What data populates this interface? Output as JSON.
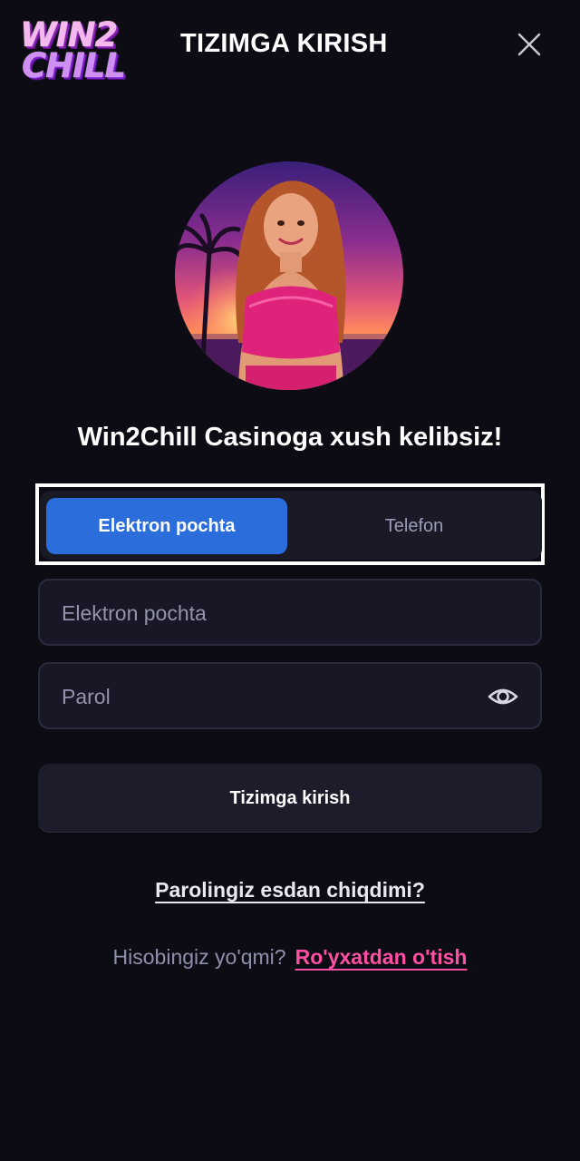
{
  "header": {
    "logo_line1": "WIN2",
    "logo_line2": "CHILL",
    "title": "TIZIMGA KIRISH",
    "close_icon": "close-icon"
  },
  "welcome": "Win2Chill Casinoga xush kelibsiz!",
  "tabs": [
    {
      "label": "Elektron pochta",
      "active": true
    },
    {
      "label": "Telefon",
      "active": false
    }
  ],
  "email_field": {
    "value": "",
    "placeholder": "Elektron pochta"
  },
  "password_field": {
    "value": "",
    "placeholder": "Parol",
    "toggle_icon": "eye-icon"
  },
  "login_button": "Tizimga kirish",
  "forgot_link": "Parolingiz esdan chiqdimi?",
  "register": {
    "question": "Hisobingiz yo'qmi?",
    "link": "Ro'yxatdan o'tish"
  },
  "colors": {
    "background": "#0d0c15",
    "accent_blue": "#2b6ddb",
    "accent_pink": "#ff4fa3",
    "field_bg": "#171725"
  }
}
